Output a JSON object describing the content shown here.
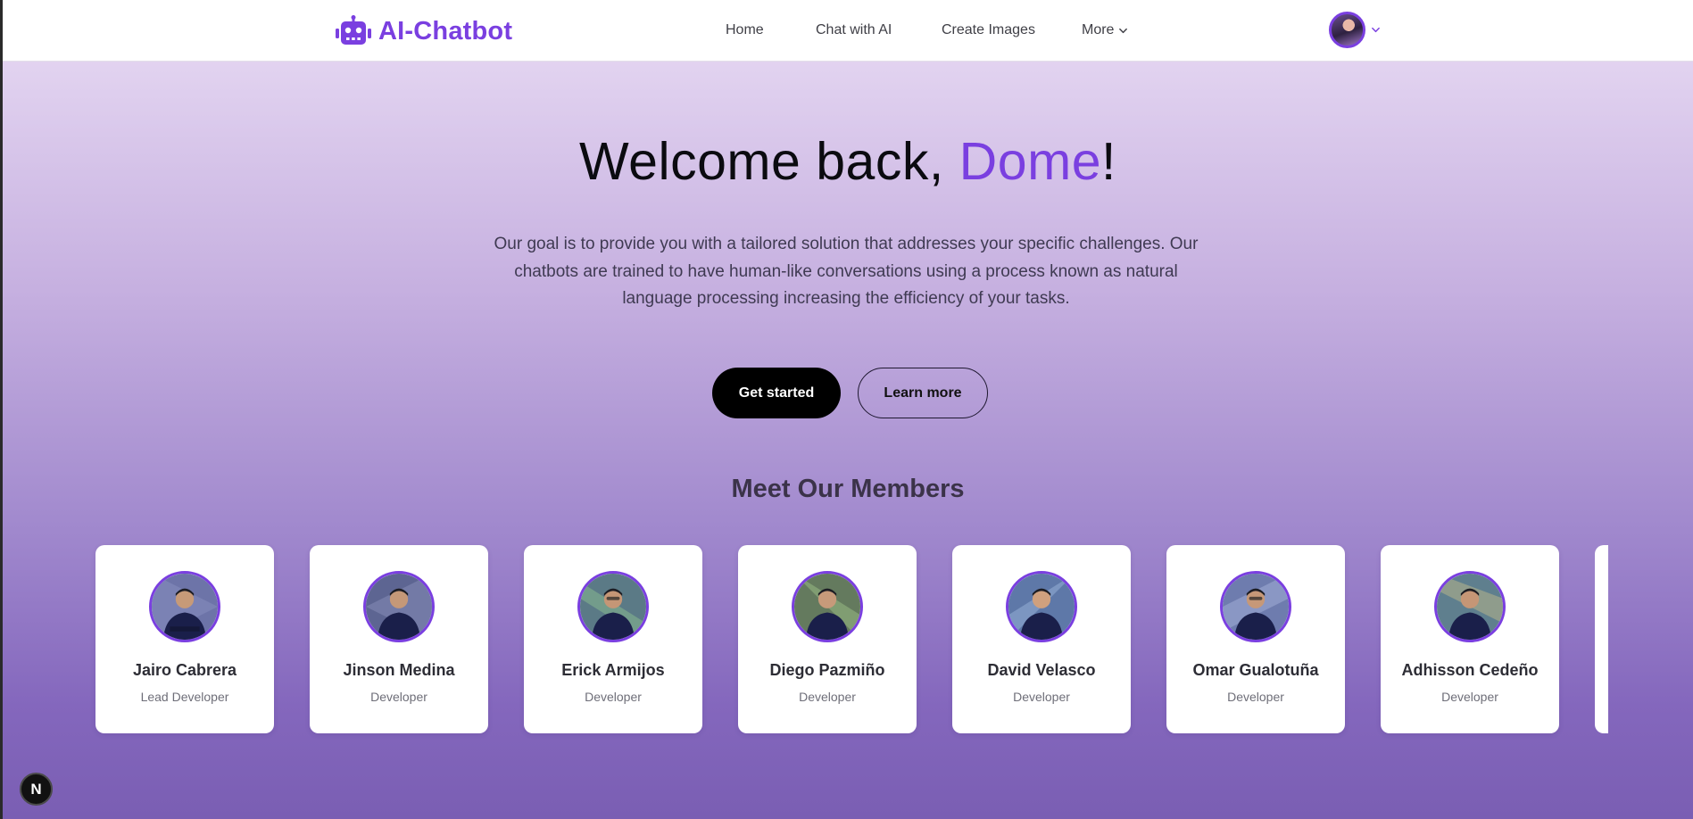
{
  "header": {
    "logo_text": "AI-Chatbot",
    "nav": {
      "home": "Home",
      "chat": "Chat with AI",
      "images": "Create Images",
      "more": "More"
    }
  },
  "hero": {
    "title_prefix": "Welcome back, ",
    "user_name": "Dome",
    "title_suffix": "!",
    "description": "Our goal is to provide you with a tailored solution that addresses your specific challenges. Our chatbots are trained to have human-like conversations using a process known as natural language processing increasing the efficiency of your tasks.",
    "primary_button": "Get started",
    "secondary_button": "Learn more"
  },
  "members": {
    "title": "Meet Our Members",
    "list": [
      {
        "name": "Jairo Cabrera",
        "role": "Lead Developer"
      },
      {
        "name": "Jinson Medina",
        "role": "Developer"
      },
      {
        "name": "Erick Armijos",
        "role": "Developer"
      },
      {
        "name": "Diego Pazmiño",
        "role": "Developer"
      },
      {
        "name": "David Velasco",
        "role": "Developer"
      },
      {
        "name": "Omar Gualotuña",
        "role": "Developer"
      },
      {
        "name": "Adhisson Cedeño",
        "role": "Developer"
      }
    ]
  },
  "badge": {
    "label": "N"
  },
  "colors": {
    "accent": "#7a3fe0",
    "primary_button_bg": "#000000"
  },
  "icons": {
    "logo": "robot-icon",
    "more": "chevron-down-icon",
    "user_menu": "chevron-down-icon"
  }
}
